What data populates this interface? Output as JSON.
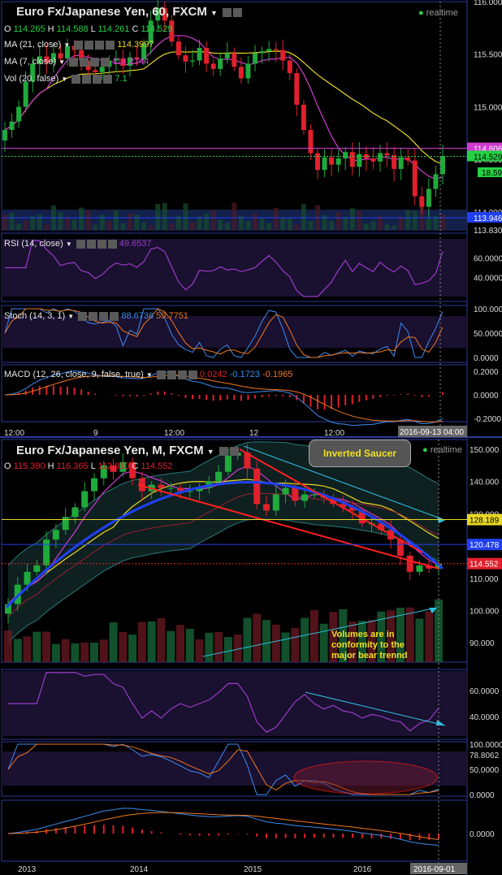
{
  "chart1": {
    "title": "Euro Fx/Japanese Yen, 60, FXCM",
    "ohlc": {
      "o_label": "O",
      "o": "114.265",
      "h_label": "H",
      "h": "114.588",
      "l_label": "L",
      "l": "114.261",
      "c_label": "C",
      "c": "114.529"
    },
    "realtime": "realtime",
    "ma21": {
      "label": "MA (21, close)",
      "value": "114.3997"
    },
    "ma7": {
      "label": "MA (7, close)",
      "value": "114.2744"
    },
    "vol": {
      "label": "Vol (20, false)",
      "value": "7.1"
    },
    "price_ticks": [
      "116.000",
      "115.500",
      "115.000",
      "114.500",
      "114.000"
    ],
    "price_badges": {
      "upper": "114.606",
      "current": "114.529",
      "vol": "18.59",
      "lower": "113.946",
      "bottom": "113.830"
    },
    "rsi": {
      "label": "RSI (14, close)",
      "value": "49.6537",
      "ticks": [
        "60.0000",
        "40.0000"
      ]
    },
    "stoch": {
      "label": "Stoch (14, 3, 1)",
      "k": "88.6736",
      "d": "59.7751",
      "ticks": [
        "100.0000",
        "50.0000",
        "0.0000"
      ]
    },
    "macd": {
      "label": "MACD (12, 26, close, 9, false, true)",
      "v1": "0.0242",
      "v2": "-0.1723",
      "v3": "-0.1965",
      "ticks": [
        "0.2000",
        "0.0000",
        "-0.2000"
      ]
    },
    "x_ticks": [
      "12:00",
      "9",
      "12:00",
      "12",
      "12:00"
    ],
    "x_cursor": "2016-09-13 04:00"
  },
  "chart2": {
    "title": "Euro Fx/Japanese Yen, M, FXCM",
    "realtime": "realtime",
    "ohlc": {
      "o_label": "O",
      "o": "115.390",
      "h_label": "H",
      "h": "116.365",
      "l_label": "L",
      "l": "112.810",
      "c_label": "C",
      "c": "114.552"
    },
    "price_ticks": [
      "150.000",
      "140.000",
      "130.000",
      "110.000",
      "100.000",
      "90.000"
    ],
    "price_badges": {
      "upper": "128.189",
      "mid": "120.478",
      "current": "114.552"
    },
    "annotations": {
      "saucer": "Inverted Saucer",
      "volumes": "Volumes are in conformity to the major bear trennd"
    },
    "rsi_ticks": [
      "60.0000",
      "40.0000"
    ],
    "stoch_ticks": [
      "100.0000",
      "78.8062",
      "50.0000",
      "0.0000"
    ],
    "macd_ticks": [
      "0.0000"
    ],
    "x_ticks": [
      "2013",
      "2014",
      "2015",
      "2016"
    ],
    "x_cursor": "2016-09-01"
  },
  "colors": {
    "up": "#1faa3c",
    "down": "#e0202c",
    "ma21": "#e8d824",
    "ma7": "#d03cd0",
    "rsi": "#9a3cc8",
    "stoch_k": "#3c8cf0",
    "stoch_d": "#f07820",
    "macd_hist": "#e0202c",
    "blue_line": "#2040f0",
    "cyan_line": "#30c0e0",
    "red_trend": "#ff2020",
    "pane_bg": "#1a1030"
  },
  "chart_data": [
    {
      "type": "candlestick",
      "title": "Euro Fx/Japanese Yen, 60, FXCM",
      "ylim": [
        113.83,
        116.0
      ],
      "closes": [
        114.78,
        114.86,
        115.0,
        115.24,
        115.41,
        115.48,
        115.42,
        115.51,
        115.46,
        115.58,
        115.54,
        115.44,
        115.35,
        115.33,
        115.38,
        115.44,
        115.46,
        115.39,
        115.47,
        115.45,
        115.6,
        115.82,
        115.94,
        115.82,
        115.62,
        115.49,
        115.43,
        115.44,
        115.56,
        115.41,
        115.36,
        115.46,
        115.51,
        115.38,
        115.27,
        115.41,
        115.51,
        115.53,
        115.55,
        115.54,
        115.44,
        115.32,
        115.02,
        114.78,
        114.56,
        114.4,
        114.52,
        114.45,
        114.51,
        114.57,
        114.43,
        114.55,
        114.51,
        114.48,
        114.56,
        114.54,
        114.41,
        114.52,
        114.49,
        114.15,
        114.05,
        114.22,
        114.36,
        114.53
      ]
    },
    {
      "type": "candlestick",
      "title": "Euro Fx/Japanese Yen, M, FXCM",
      "ylim": [
        84,
        152
      ],
      "closes": [
        102,
        108,
        112,
        114,
        122,
        125,
        129,
        132,
        137,
        141,
        145,
        143,
        146,
        141,
        137,
        139,
        138,
        138,
        137,
        137,
        138,
        140,
        143,
        148,
        149,
        144,
        133,
        131,
        136,
        138,
        134,
        136,
        136,
        135,
        133,
        132,
        131,
        127,
        127,
        125,
        122,
        117,
        112,
        114,
        113,
        114.55
      ]
    }
  ]
}
